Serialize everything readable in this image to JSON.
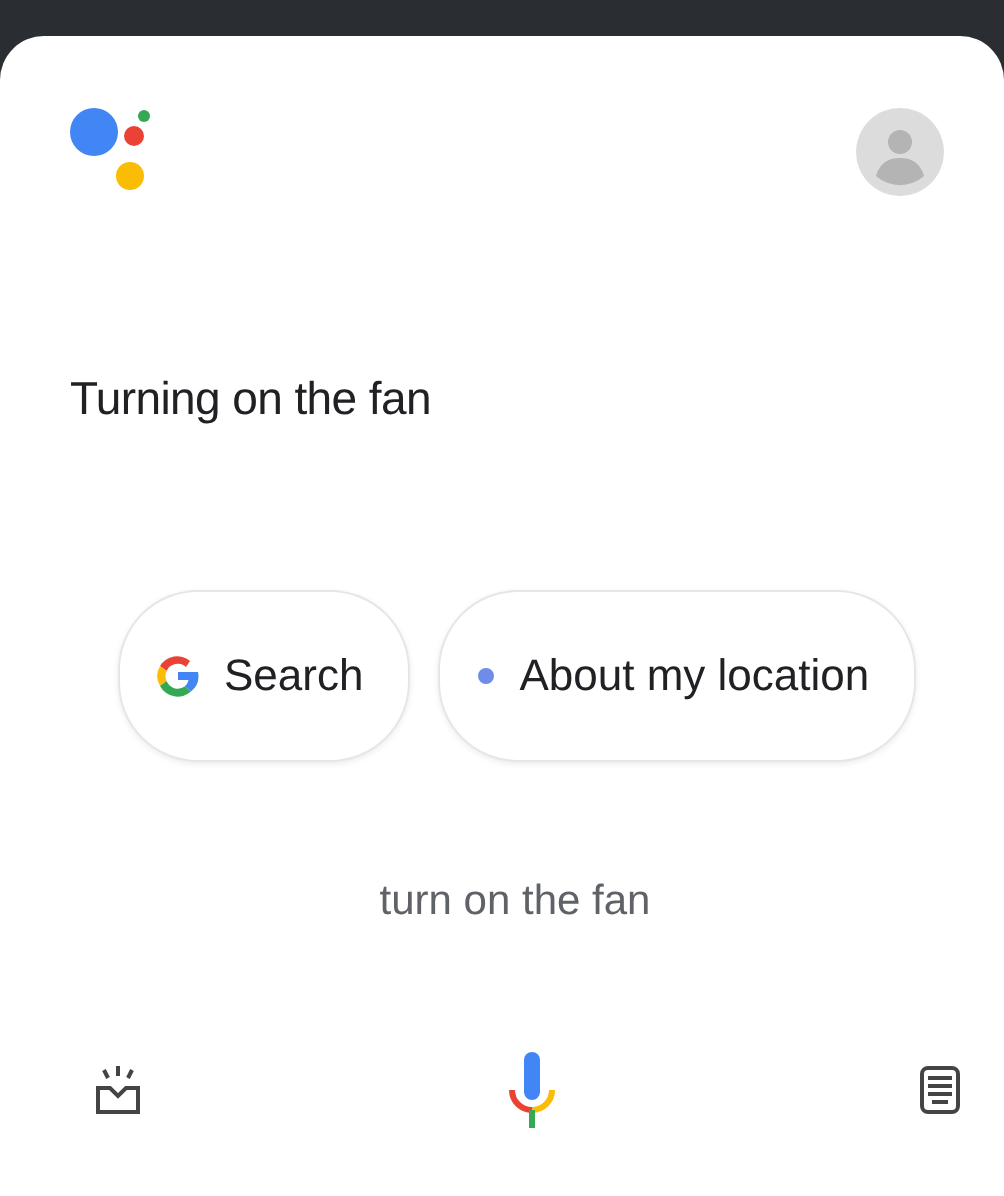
{
  "response": "Turning on the fan",
  "chips": [
    {
      "kind": "google",
      "label": "Search"
    },
    {
      "kind": "dot",
      "label": "About my location"
    }
  ],
  "query": "turn on the fan"
}
